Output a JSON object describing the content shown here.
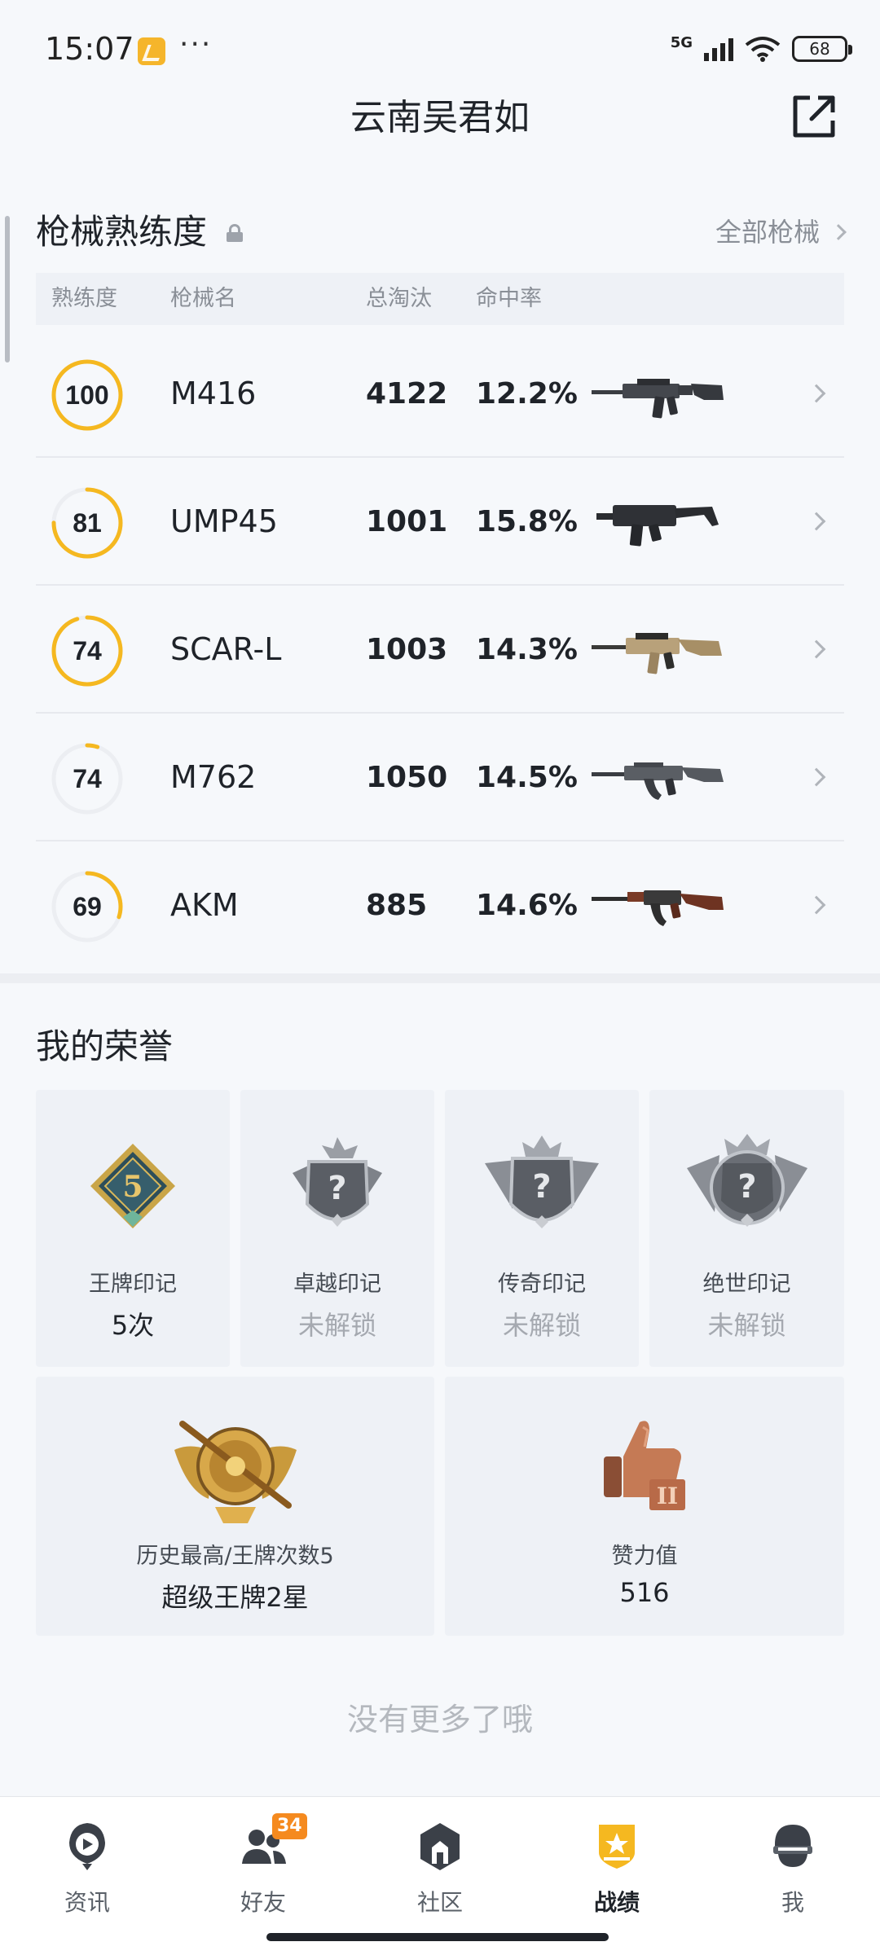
{
  "status_bar": {
    "time": "15:07",
    "dots": "···",
    "network": "5G",
    "battery": "68"
  },
  "header": {
    "title": "云南吴君如"
  },
  "weapons": {
    "section_title": "枪械熟练度",
    "all_link": "全部枪械",
    "columns": [
      "熟练度",
      "枪械名",
      "总淘汰",
      "命中率"
    ],
    "items": [
      {
        "proficiency": "100",
        "progress": 1.0,
        "name": "M416",
        "kills": "4122",
        "accuracy": "12.2%",
        "icon": "m416-rifle-icon"
      },
      {
        "proficiency": "81",
        "progress": 0.75,
        "name": "UMP45",
        "kills": "1001",
        "accuracy": "15.8%",
        "icon": "ump45-smg-icon"
      },
      {
        "proficiency": "74",
        "progress": 0.95,
        "name": "SCAR-L",
        "kills": "1003",
        "accuracy": "14.3%",
        "icon": "scarl-rifle-icon"
      },
      {
        "proficiency": "74",
        "progress": 0.05,
        "name": "M762",
        "kills": "1050",
        "accuracy": "14.5%",
        "icon": "m762-rifle-icon"
      },
      {
        "proficiency": "69",
        "progress": 0.3,
        "name": "AKM",
        "kills": "885",
        "accuracy": "14.6%",
        "icon": "akm-rifle-icon"
      }
    ]
  },
  "honors": {
    "title": "我的荣誉",
    "marks": [
      {
        "name": "王牌印记",
        "value": "5次",
        "locked": false,
        "icon": "ace-mark-icon"
      },
      {
        "name": "卓越印记",
        "value": "未解锁",
        "locked": true,
        "icon": "excellence-mark-icon"
      },
      {
        "name": "传奇印记",
        "value": "未解锁",
        "locked": true,
        "icon": "legend-mark-icon"
      },
      {
        "name": "绝世印记",
        "value": "未解锁",
        "locked": true,
        "icon": "peerless-mark-icon"
      }
    ],
    "rank": {
      "label": "历史最高/王牌次数5",
      "value": "超级王牌2星",
      "icon": "rank-badge-icon"
    },
    "likes": {
      "label": "赞力值",
      "value": "516",
      "icon": "thumbs-up-trophy-icon"
    }
  },
  "footer_text": "没有更多了哦",
  "nav": {
    "items": [
      {
        "label": "资讯",
        "icon": "news-icon",
        "active": false
      },
      {
        "label": "好友",
        "icon": "friends-icon",
        "badge": "34",
        "active": false
      },
      {
        "label": "社区",
        "icon": "community-icon",
        "active": false
      },
      {
        "label": "战绩",
        "icon": "record-icon",
        "active": true
      },
      {
        "label": "我",
        "icon": "profile-icon",
        "active": false
      }
    ]
  },
  "colors": {
    "accent": "#f5b820",
    "background": "#f6f8fb",
    "card": "#eef1f6",
    "badge": "#f58a1f"
  }
}
